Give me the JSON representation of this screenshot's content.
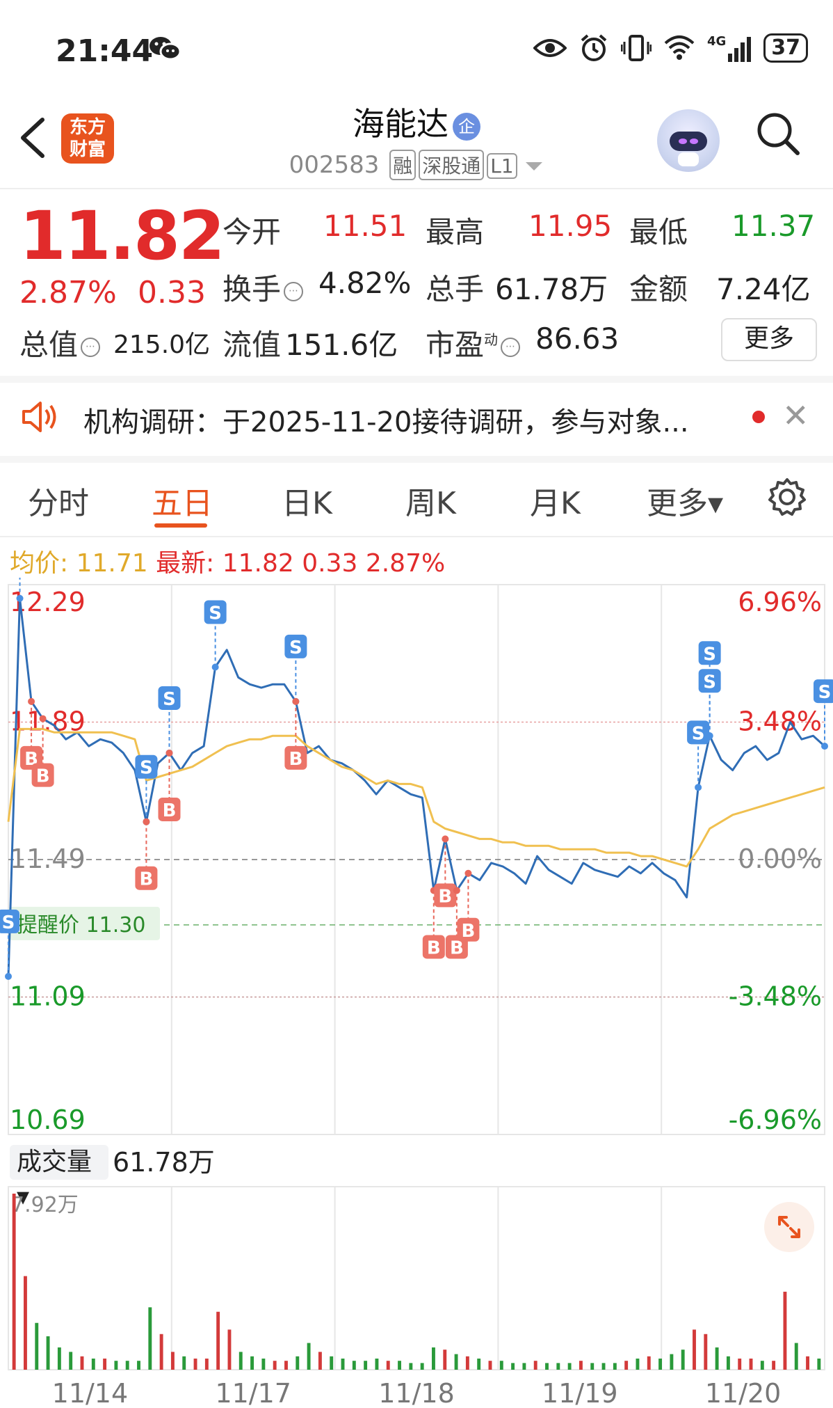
{
  "status_bar": {
    "time": "21:44",
    "battery": "37",
    "network": "4G"
  },
  "header": {
    "stock_name": "海能达",
    "enterprise_badge": "企",
    "code": "002583",
    "tags": [
      "融",
      "深股通",
      "L1"
    ],
    "logo_text": "东方\n财富"
  },
  "quote": {
    "price": "11.82",
    "change_pct": "2.87%",
    "change": "0.33",
    "fields": {
      "open_label": "今开",
      "open": "11.51",
      "high_label": "最高",
      "high": "11.95",
      "low_label": "最低",
      "low": "11.37",
      "turnover_label": "换手",
      "turnover": "4.82%",
      "volume_label": "总手",
      "volume": "61.78万",
      "amount_label": "金额",
      "amount": "7.24亿",
      "mktcap_label": "总值",
      "mktcap": "215.0亿",
      "float_label": "流值",
      "float": "151.6亿",
      "pe_label": "市盈",
      "pe_super": "动",
      "pe": "86.63"
    },
    "more_label": "更多"
  },
  "notice": {
    "text": "机构调研：于2025-11-20接待调研，参与对象..."
  },
  "tabs": {
    "items": [
      "分时",
      "五日",
      "日K",
      "周K",
      "月K",
      "更多▾"
    ],
    "active": 1
  },
  "chart_header": {
    "avg_label": "均价:",
    "avg": "11.71",
    "latest_label": "最新:",
    "latest": "11.82",
    "chg": "0.33",
    "pct": "2.87%"
  },
  "chart_data": {
    "type": "line",
    "x_dates": [
      "11/14",
      "11/17",
      "11/18",
      "11/19",
      "11/20"
    ],
    "y_ticks_left": [
      "12.29",
      "11.89",
      "11.49",
      "11.09",
      "10.69"
    ],
    "y_ticks_right": [
      "6.96%",
      "3.48%",
      "0.00%",
      "-3.48%",
      "-6.96%"
    ],
    "ylim": [
      10.69,
      12.29
    ],
    "prev_close": 11.49,
    "alert_price_label": "提醒价 11.30",
    "alert_price": 11.3,
    "series": [
      {
        "name": "price",
        "color": "#2f6db5",
        "values": [
          11.15,
          12.25,
          11.95,
          11.9,
          11.88,
          11.84,
          11.86,
          11.82,
          11.84,
          11.83,
          11.8,
          11.75,
          11.6,
          11.77,
          11.8,
          11.75,
          11.8,
          11.82,
          12.05,
          12.1,
          12.02,
          12.0,
          11.99,
          12.0,
          12.0,
          11.95,
          11.8,
          11.82,
          11.78,
          11.77,
          11.75,
          11.72,
          11.68,
          11.72,
          11.7,
          11.68,
          11.67,
          11.4,
          11.55,
          11.4,
          11.45,
          11.43,
          11.48,
          11.47,
          11.45,
          11.42,
          11.5,
          11.46,
          11.44,
          11.42,
          11.48,
          11.46,
          11.45,
          11.44,
          11.47,
          11.45,
          11.48,
          11.45,
          11.43,
          11.38,
          11.7,
          11.85,
          11.78,
          11.75,
          11.8,
          11.82,
          11.78,
          11.8,
          11.89,
          11.84,
          11.85,
          11.82
        ]
      },
      {
        "name": "avg",
        "color": "#f0c050",
        "values": [
          11.6,
          11.87,
          11.87,
          11.87,
          11.86,
          11.86,
          11.86,
          11.86,
          11.86,
          11.86,
          11.85,
          11.84,
          11.72,
          11.73,
          11.74,
          11.75,
          11.76,
          11.78,
          11.8,
          11.82,
          11.83,
          11.84,
          11.84,
          11.85,
          11.85,
          11.85,
          11.82,
          11.8,
          11.78,
          11.76,
          11.75,
          11.73,
          11.71,
          11.72,
          11.71,
          11.71,
          11.7,
          11.6,
          11.58,
          11.57,
          11.56,
          11.55,
          11.55,
          11.54,
          11.54,
          11.53,
          11.53,
          11.53,
          11.52,
          11.52,
          11.52,
          11.52,
          11.51,
          11.51,
          11.51,
          11.5,
          11.5,
          11.49,
          11.48,
          11.47,
          11.52,
          11.58,
          11.6,
          11.62,
          11.63,
          11.64,
          11.65,
          11.66,
          11.67,
          11.68,
          11.69,
          11.7
        ]
      }
    ],
    "markers": [
      {
        "type": "S",
        "idx": 0
      },
      {
        "type": "S",
        "idx": 1
      },
      {
        "type": "B",
        "idx": 2
      },
      {
        "type": "B",
        "idx": 3
      },
      {
        "type": "S",
        "idx": 12
      },
      {
        "type": "B",
        "idx": 12
      },
      {
        "type": "S",
        "idx": 14
      },
      {
        "type": "B",
        "idx": 14
      },
      {
        "type": "S",
        "idx": 18
      },
      {
        "type": "S",
        "idx": 25
      },
      {
        "type": "B",
        "idx": 25
      },
      {
        "type": "B",
        "idx": 37
      },
      {
        "type": "B",
        "idx": 38
      },
      {
        "type": "B",
        "idx": 39
      },
      {
        "type": "B",
        "idx": 40
      },
      {
        "type": "S",
        "idx": 60
      },
      {
        "type": "S",
        "idx": 61
      },
      {
        "type": "S",
        "idx": 61
      },
      {
        "type": "S",
        "idx": 71
      }
    ],
    "volume": {
      "label": "成交量",
      "total": "61.78万",
      "max_label": "7.92万",
      "values": [
        7.9,
        4.2,
        2.1,
        1.5,
        1.0,
        0.8,
        0.6,
        0.5,
        0.5,
        0.4,
        0.4,
        0.4,
        2.8,
        1.6,
        0.8,
        0.6,
        0.5,
        0.5,
        2.6,
        1.8,
        0.8,
        0.6,
        0.5,
        0.4,
        0.4,
        0.6,
        1.2,
        0.8,
        0.6,
        0.5,
        0.4,
        0.4,
        0.5,
        0.4,
        0.4,
        0.3,
        0.3,
        1.0,
        0.9,
        0.7,
        0.6,
        0.5,
        0.4,
        0.4,
        0.3,
        0.3,
        0.4,
        0.3,
        0.3,
        0.3,
        0.4,
        0.3,
        0.3,
        0.3,
        0.4,
        0.5,
        0.6,
        0.5,
        0.7,
        0.9,
        1.8,
        1.6,
        1.0,
        0.6,
        0.5,
        0.5,
        0.4,
        0.4,
        3.5,
        1.2,
        0.6,
        0.5
      ]
    }
  }
}
